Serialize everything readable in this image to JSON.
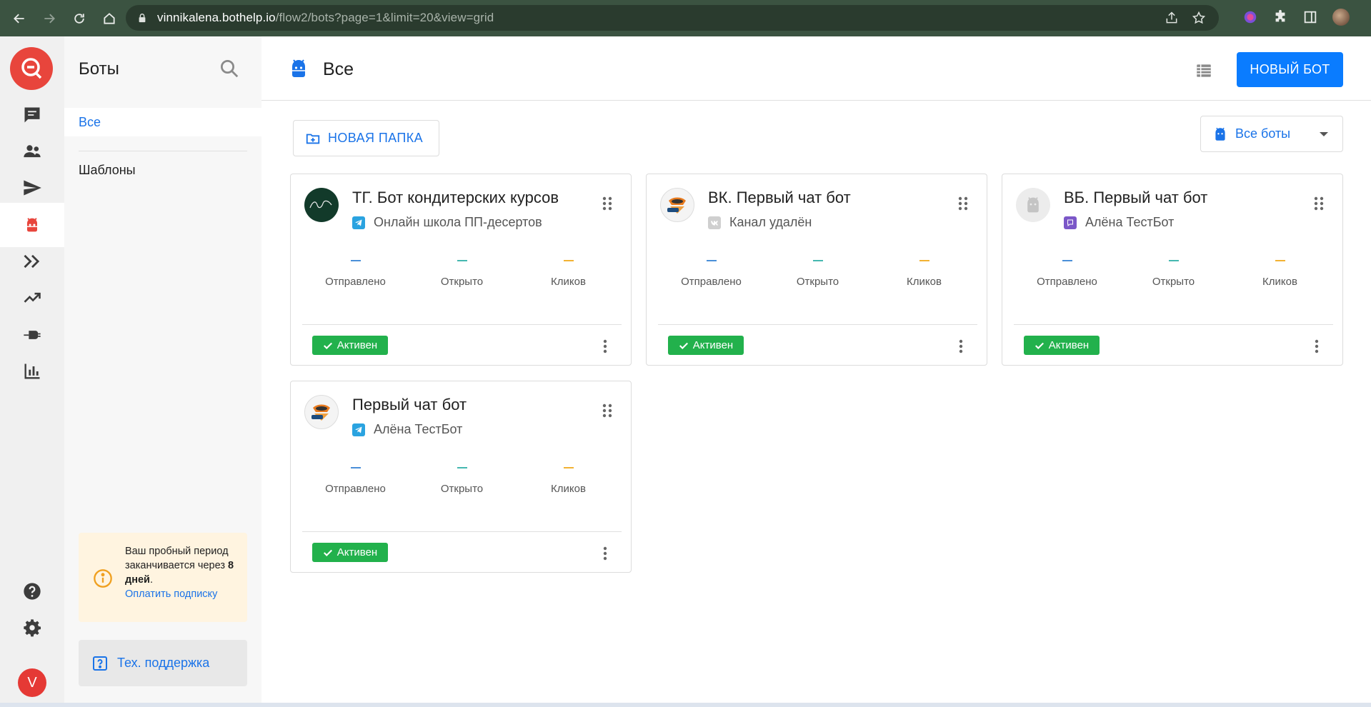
{
  "browser": {
    "url_host": "vinnikalena.bothelp.io",
    "url_path": "/flow2/bots?page=1&limit=20&view=grid"
  },
  "sidebar": {
    "title": "Боты",
    "items": [
      {
        "label": "Все"
      },
      {
        "label": "Шаблоны"
      }
    ],
    "trial": {
      "line1": "Ваш пробный период заканчивается через ",
      "days": "8 дней",
      "dot": ".",
      "pay_link": "Оплатить подписку"
    },
    "support_label": "Тех. поддержка"
  },
  "rail": {
    "user_initial": "V"
  },
  "header": {
    "title": "Все",
    "new_bot_label": "НОВЫЙ БОТ"
  },
  "toolbar": {
    "new_folder_label": "НОВАЯ ПАПКА",
    "filter_value": "Все боты"
  },
  "stat_labels": {
    "sent": "Отправлено",
    "opened": "Открыто",
    "clicks": "Кликов"
  },
  "bots": [
    {
      "name": "ТГ. Бот кондитерских курсов",
      "channel": "Онлайн школа ПП-десертов",
      "channel_type": "telegram",
      "status": "Активен"
    },
    {
      "name": "ВК. Первый чат бот",
      "channel": "Канал удалён",
      "channel_type": "vk-deleted",
      "status": "Активен"
    },
    {
      "name": "ВБ. Первый чат бот",
      "channel": "Алёна ТестБот",
      "channel_type": "viber",
      "status": "Активен"
    },
    {
      "name": "Первый чат бот",
      "channel": "Алёна ТестБот",
      "channel_type": "telegram",
      "status": "Активен"
    }
  ],
  "colors": {
    "accent": "#0a7cff",
    "active_badge": "#22b14c",
    "telegram": "#2aa3e0",
    "viber": "#7b57c8"
  }
}
